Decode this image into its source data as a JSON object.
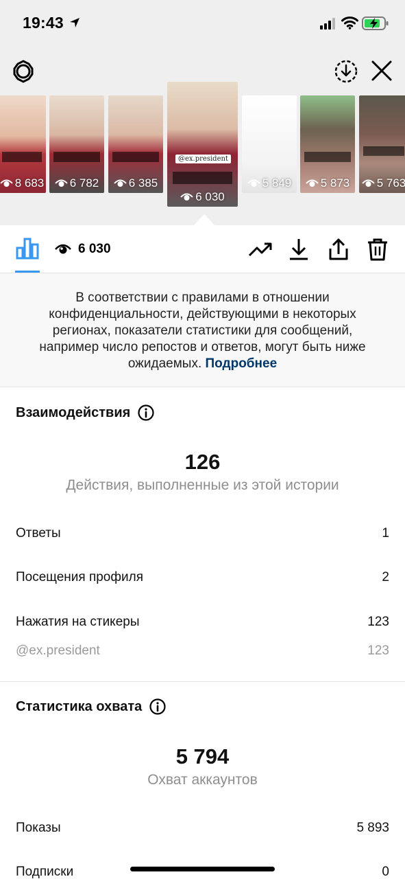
{
  "status_bar": {
    "time": "19:43"
  },
  "story_viewer": {
    "thumbnails": [
      {
        "views": "8 683",
        "tone": "#b53a3f",
        "active": false
      },
      {
        "views": "6 782",
        "tone": "#9e2c36",
        "active": false
      },
      {
        "views": "6 385",
        "tone": "#a32d3b",
        "active": false
      },
      {
        "views": "6 030",
        "tone": "#8e2433",
        "active": true,
        "mention": "@ex.president"
      },
      {
        "views": "5 849",
        "tone": "#f6f6f6",
        "active": false
      },
      {
        "views": "5 873",
        "tone": "#a07a6e",
        "active": false
      },
      {
        "views": "5 763",
        "tone": "#7b5b52",
        "active": false
      }
    ]
  },
  "toolbar": {
    "views": "6 030"
  },
  "notice": {
    "text": "В соответствии с правилами в отношении конфиденциальности, действующими в некоторых регионах, показатели статистики для сообщений, например число репостов и ответов, могут быть ниже ожидаемых.",
    "link": "Подробнее"
  },
  "interactions": {
    "title": "Взаимодействия",
    "total": "126",
    "caption": "Действия, выполненные из этой истории",
    "rows": [
      {
        "label": "Ответы",
        "value": "1"
      },
      {
        "label": "Посещения профиля",
        "value": "2"
      },
      {
        "label": "Нажатия на стикеры",
        "value": "123"
      },
      {
        "label": "@ex.president",
        "value": "123"
      }
    ]
  },
  "reach": {
    "title": "Статистика охвата",
    "total": "5 794",
    "caption": "Охват аккаунтов",
    "rows": [
      {
        "label": "Показы",
        "value": "5 893"
      },
      {
        "label": "Подписки",
        "value": "0"
      }
    ]
  },
  "colors": {
    "accent": "#3897f0",
    "link": "#00376b",
    "muted": "#8e8e8e"
  }
}
